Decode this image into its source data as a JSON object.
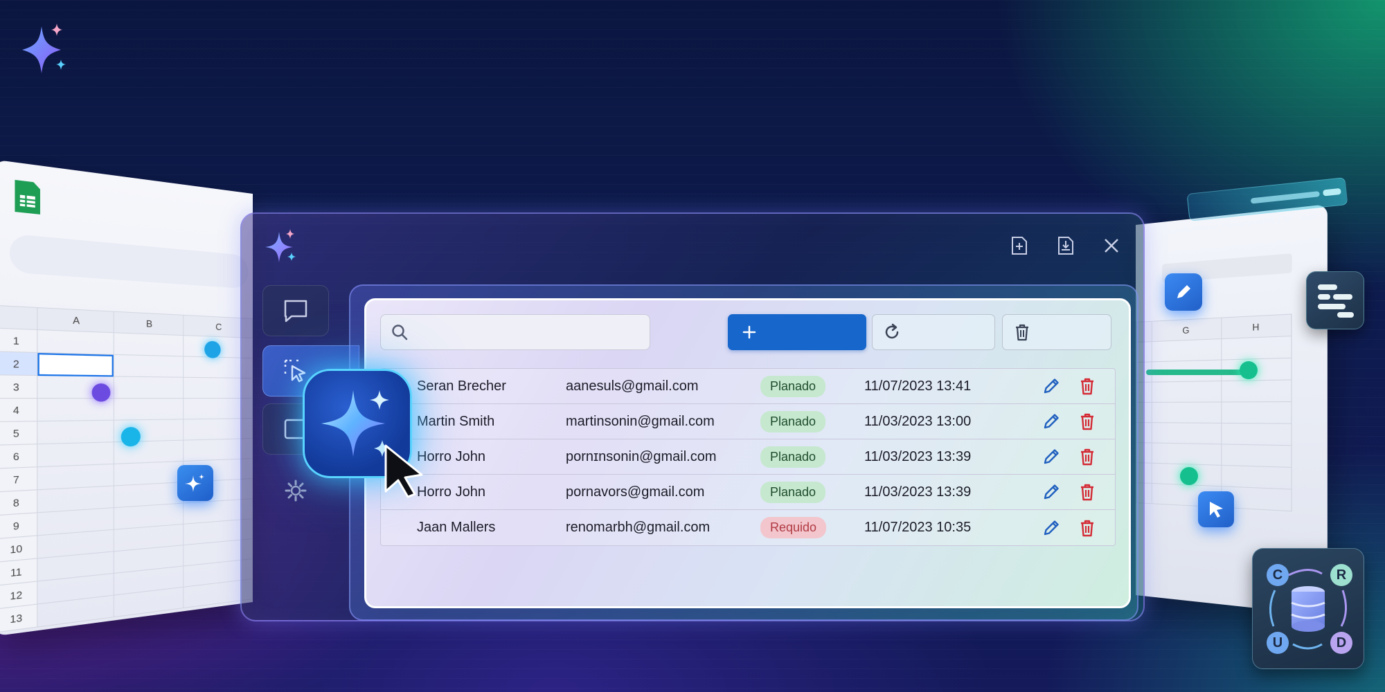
{
  "toolbar": {
    "search_placeholder": "",
    "add_label": "",
    "refresh_label": "",
    "delete_label": ""
  },
  "sheet_left": {
    "columns": [
      "A",
      "B",
      "C"
    ],
    "rows": [
      "1",
      "2",
      "3",
      "4",
      "5",
      "6",
      "7",
      "8",
      "9",
      "10",
      "11",
      "12",
      "13"
    ]
  },
  "sheet_right": {
    "columns": [
      "G",
      "H"
    ]
  },
  "crud": {
    "c": "C",
    "r": "R",
    "u": "U",
    "d": "D"
  },
  "table": {
    "rows": [
      {
        "name": "Seran Brecher",
        "email": "aanesuls@gmail.com",
        "status": "Planado",
        "status_type": "ok",
        "date": "11/07/2023 13:41"
      },
      {
        "name": "Martin Smith",
        "email": "martinsonin@gmail.com",
        "status": "Planado",
        "status_type": "ok",
        "date": "11/03/2023 13:00"
      },
      {
        "name": "Horro John",
        "email": "pornɪnsonin@gmail.com",
        "status": "Planado",
        "status_type": "ok",
        "date": "11/03/2023 13:39"
      },
      {
        "name": "Horro John",
        "email": "pornavors@gmail.com",
        "status": "Planado",
        "status_type": "ok",
        "date": "11/03/2023 13:39"
      },
      {
        "name": "Jaan Mallers",
        "email": "renomarbh@gmail.com",
        "status": "Requido",
        "status_type": "req",
        "date": "11/07/2023 10:35"
      }
    ]
  },
  "colors": {
    "primary": "#1766cc",
    "status_ok_bg": "#c6e8cf",
    "status_req_bg": "#f2c6cc",
    "edit_icon": "#1f5fbf",
    "delete_icon": "#d42a35"
  },
  "icons": {
    "window": [
      "new-file-icon",
      "save-file-icon",
      "close-icon"
    ],
    "sidebar": [
      "chat-icon",
      "select-cursor-icon",
      "image-icon",
      "gear-icon"
    ],
    "row_actions": [
      "pencil-icon",
      "trash-icon"
    ]
  }
}
